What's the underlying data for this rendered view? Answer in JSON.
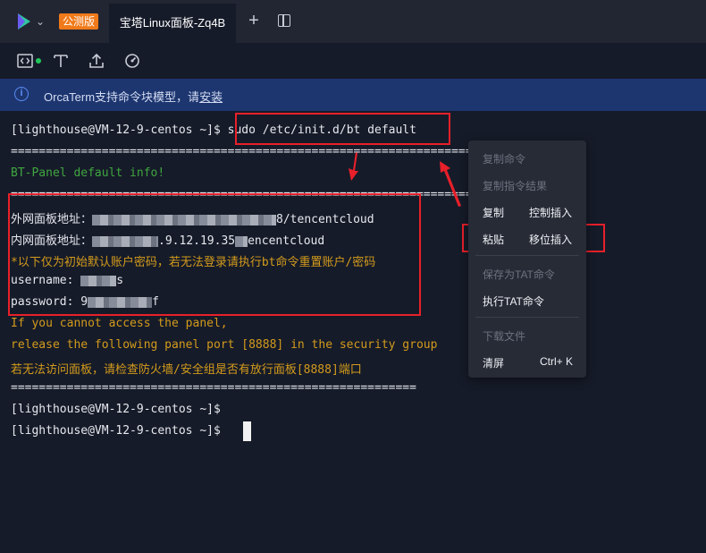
{
  "tabbar": {
    "badge": "公测版",
    "active_tab": "宝塔Linux面板-Zq4B",
    "new_tab": "+"
  },
  "toolbar": {
    "icons": [
      "code-panel-icon",
      "text-icon",
      "upload-icon",
      "gauge-icon"
    ],
    "status_color": "#21c75a"
  },
  "info": {
    "icon": "i",
    "text": "OrcaTerm支持命令块模型，请",
    "link": "安装"
  },
  "terminal": {
    "prompt1": "[lighthouse@VM-12-9-centos ~]$ ",
    "command": "sudo /etc/init.d/bt default",
    "separator": "==================================================================",
    "title": "BT-Panel default info!",
    "outer_label": "外网面板地址：",
    "outer_tail": "8/tencentcloud",
    "inner_label": "内网面板地址：",
    "inner_mid": ".9.12.19.35",
    "inner_tail": "encentcloud",
    "notice": "*以下仅为初始默认账户密码，若无法登录请执行bt命令重置账户/密码",
    "username_label": "username: ",
    "username_tail": "s",
    "password_label": "password: ",
    "password_head": "9",
    "password_tail": "f",
    "warn1": "If you cannot access the panel,",
    "warn2": "release the following panel port [8888] in the security group",
    "warn3": "若无法访问面板，请检查防火墙/安全组是否有放行面板[8888]端口",
    "separator2": "==========================================================",
    "prompt2": "[lighthouse@VM-12-9-centos ~]$",
    "prompt3": "[lighthouse@VM-12-9-centos ~]$"
  },
  "context_menu": {
    "copy_command": "复制命令",
    "copy_result": "复制指令结果",
    "copy": "复制",
    "control_insert": "控制插入",
    "paste": "粘贴",
    "shift_insert": "移位插入",
    "save_tat": "保存为TAT命令",
    "run_tat": "执行TAT命令",
    "download": "下载文件",
    "clear": "清屏",
    "clear_shortcut": "Ctrl+ K"
  }
}
